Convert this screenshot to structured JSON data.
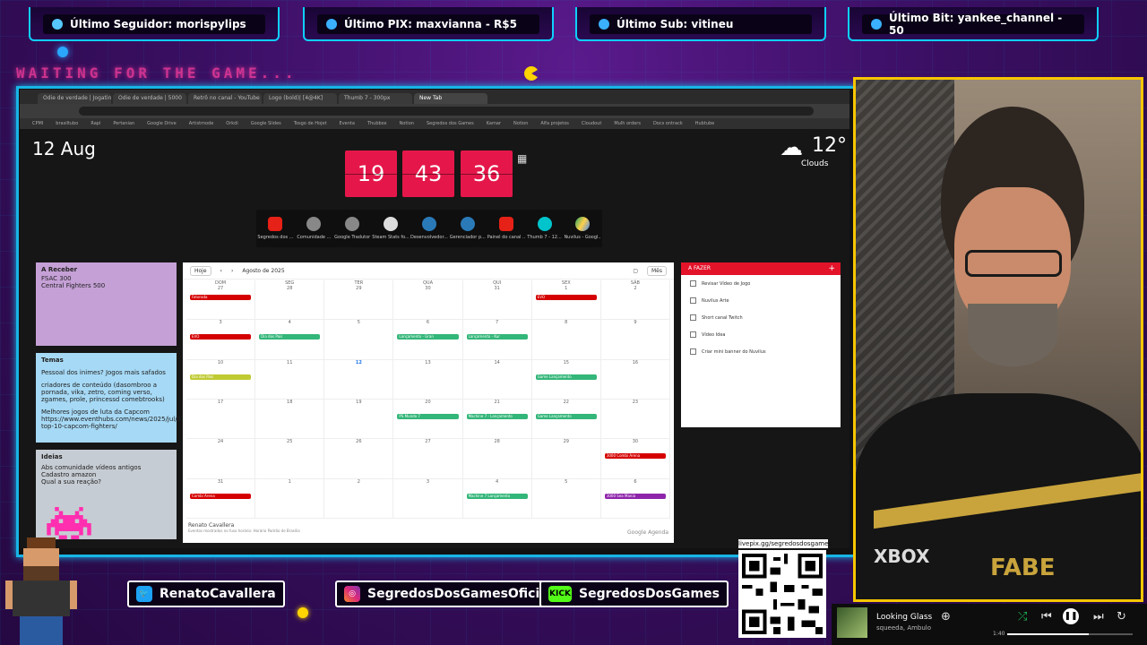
{
  "banners": {
    "follower": "Último Seguidor: morispylips",
    "pix": "Último PIX: maxvianna - R$5",
    "sub": "Último Sub: vitineu",
    "bit": "Último Bit: yankee_channel - 50"
  },
  "waiting_text": "WAITING FOR THE GAME...",
  "browser": {
    "tabs": [
      "Odie de verdade | Jogatina",
      "Odie de verdade | 5000",
      "Retrô no canal - YouTube",
      "Logo (bold)| [4@4K]",
      "Thumb 7 - 300px",
      "New Tab"
    ],
    "bookmarks": [
      "CPMI",
      "brasiltubo",
      "Rapi",
      "Pertanian",
      "Google Drive",
      "Artistmode",
      "Orkdi",
      "Google Slides",
      "Tosgo de Hojet",
      "Eventa",
      "Thubbox",
      "Notion",
      "Segredos dos Games",
      "Kamar",
      "Notion",
      "Alfa projetos",
      "Cloudout",
      "Mulh orders",
      "Docs ontrack",
      "Hubtube"
    ]
  },
  "newtab": {
    "date": "12 Aug",
    "hours": "19",
    "minutes": "43",
    "seconds": "36",
    "temperature": "12°",
    "condition": "Clouds",
    "shortcuts": [
      {
        "label": "Segredos dos ...",
        "color": "#e62117"
      },
      {
        "label": "Comunidade ...",
        "color": "#888888"
      },
      {
        "label": "Google Tradutor",
        "color": "#888888"
      },
      {
        "label": "Steam Stats fo...",
        "color": "#1b2838"
      },
      {
        "label": "Desenvolvedor...",
        "color": "#1b2838"
      },
      {
        "label": "Gerenciador p...",
        "color": "#1b2838"
      },
      {
        "label": "Painel do canal ...",
        "color": "#e62117"
      },
      {
        "label": "Thumb 7 - 12...",
        "color": "#00c4cc"
      },
      {
        "label": "Nuvilus - Googl...",
        "color": "#1fa463"
      }
    ]
  },
  "notes": {
    "n1": {
      "title": "A Receber",
      "lines": [
        "FSAC 300",
        "Central Fighters 500"
      ]
    },
    "n2": {
      "title": "Temas",
      "lines": [
        "Pessoal dos inimes? Jogos mais safados",
        "criadores de conteúdo (dasombroo a pornada, vika, zetro, coming verso, zgames, prole, princessd comebtrooks)",
        "Melhores jogos de luta da Capcom https://www.eventhubs.com/news/2025/jul/23/maxinilian-top-10-capcom-fighters/"
      ]
    },
    "n3": {
      "title": "Ideias",
      "lines": [
        "Abs comunidade vídeos antigos",
        "Cadastro amazon",
        "Qual a sua reação?"
      ]
    }
  },
  "calendar": {
    "today_btn": "Hoje",
    "month": "Agosto de 2025",
    "view": "Mês",
    "days": [
      "DOM",
      "SEG",
      "TER",
      "QUA",
      "QUI",
      "SEX",
      "SÁB"
    ],
    "dates": [
      "27",
      "28",
      "29",
      "30",
      "31",
      "1",
      "2",
      "3",
      "4",
      "5",
      "6",
      "7",
      "8",
      "9",
      "10",
      "11",
      "12",
      "13",
      "14",
      "15",
      "16",
      "17",
      "18",
      "19",
      "20",
      "21",
      "22",
      "23",
      "24",
      "25",
      "26",
      "27",
      "28",
      "29",
      "30",
      "31",
      "1",
      "2",
      "3",
      "4",
      "5",
      "6"
    ],
    "events": [
      {
        "cell": 0,
        "text": "Fatorada",
        "color": "#d50000"
      },
      {
        "cell": 5,
        "text": "EVO",
        "color": "#d50000"
      },
      {
        "cell": 7,
        "text": "EVO",
        "color": "#d50000"
      },
      {
        "cell": 8,
        "text": "Dia dos Pais",
        "color": "#33b679"
      },
      {
        "cell": 10,
        "text": "Lançamento - Gran",
        "color": "#33b679"
      },
      {
        "cell": 11,
        "text": "Lançamento - Kur",
        "color": "#33b679"
      },
      {
        "cell": 14,
        "text": "Dia dos Pais",
        "color": "#c0ca33"
      },
      {
        "cell": 19,
        "text": "Game Lançamento",
        "color": "#33b679"
      },
      {
        "cell": 24,
        "text": "PS Mundo 7",
        "color": "#33b679"
      },
      {
        "cell": 25,
        "text": "Machine 7 - Lançamento",
        "color": "#33b679"
      },
      {
        "cell": 26,
        "text": "Game Lançamento",
        "color": "#33b679"
      },
      {
        "cell": 34,
        "text": "3000 Combi Arena",
        "color": "#d50000"
      },
      {
        "cell": 35,
        "text": "Combi Arena",
        "color": "#d50000"
      },
      {
        "cell": 39,
        "text": "Machine 7 Lançamento",
        "color": "#33b679"
      },
      {
        "cell": 41,
        "text": "3000 Sea Mania",
        "color": "#8e24aa"
      }
    ],
    "owner": "Renato Cavallera",
    "footer": "Eventos mostrados no fuso horário: Horário Padrão de Brasília",
    "google": "Google Agenda"
  },
  "todo": {
    "title": "A FAZER",
    "items": [
      "Revisar Vídeo de Jogo",
      "Nuvilus Arte",
      "Short canal Twitch",
      "Vídeo Idea",
      "Criar mini banner do Nuvilus"
    ]
  },
  "socials": {
    "twitter": "RenatoCavallera",
    "instagram": "SegredosDosGamesOficial",
    "kick": "SegredosDosGames"
  },
  "qr_label": "livepix.gg/segredosdosgames",
  "webcam": {
    "shirt_brand": "XBOX",
    "shirt_text": "FABE"
  },
  "player": {
    "song": "Looking Glass",
    "artist": "squeeda, Ambulo",
    "time": "1:40",
    "progress": 0.65
  },
  "colors": {
    "accent": "#18b5e6",
    "cam_border": "#f7c600",
    "flip": "#e5174a",
    "todo_header": "#e3132a"
  }
}
